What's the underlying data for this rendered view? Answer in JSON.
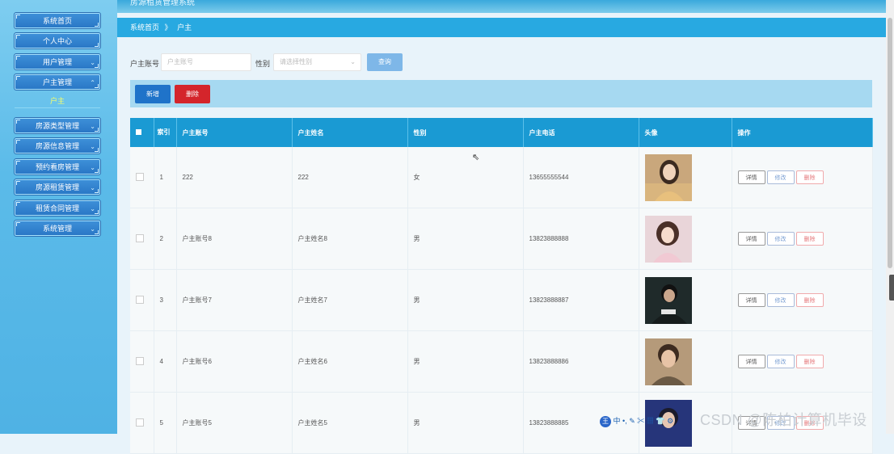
{
  "topbar": {
    "title": "房源租赁管理系统"
  },
  "sidebar": {
    "items": [
      {
        "label": "系统首页"
      },
      {
        "label": "个人中心"
      },
      {
        "label": "用户管理"
      },
      {
        "label": "户主管理"
      },
      {
        "label": "房源类型管理"
      },
      {
        "label": "房源信息管理"
      },
      {
        "label": "预约看房管理"
      },
      {
        "label": "房源租赁管理"
      },
      {
        "label": "租赁合同管理"
      },
      {
        "label": "系统管理"
      }
    ],
    "sub_item": "户主"
  },
  "breadcrumb": {
    "home": "系统首页",
    "separator": "》",
    "current": "户主"
  },
  "search": {
    "account_label": "户主账号",
    "account_placeholder": "户主账号",
    "gender_label": "性别",
    "gender_placeholder": "请选择性别",
    "search_button": "查询"
  },
  "actions": {
    "add": "新增",
    "delete": "删除"
  },
  "table": {
    "headers": [
      "",
      "索引",
      "户主账号",
      "户主姓名",
      "性别",
      "户主电话",
      "头像",
      "操作"
    ],
    "rows": [
      {
        "index": "1",
        "account": "222",
        "name": "222",
        "gender": "女",
        "phone": "13655555544"
      },
      {
        "index": "2",
        "account": "户主账号8",
        "name": "户主姓名8",
        "gender": "男",
        "phone": "13823888888"
      },
      {
        "index": "3",
        "account": "户主账号7",
        "name": "户主姓名7",
        "gender": "男",
        "phone": "13823888887"
      },
      {
        "index": "4",
        "account": "户主账号6",
        "name": "户主姓名6",
        "gender": "男",
        "phone": "13823888886"
      },
      {
        "index": "5",
        "account": "户主账号5",
        "name": "户主姓名5",
        "gender": "男",
        "phone": "13823888885"
      }
    ],
    "ops": {
      "detail": "详情",
      "edit": "修改",
      "delete": "删除"
    }
  },
  "ime_toolbar": {
    "badge": "王",
    "mode": "中"
  },
  "watermark": "CSDN @陈柏计算机毕设",
  "colors": {
    "sidebar": "#5bbbe9",
    "header": "#1a9ad3",
    "primary": "#1f73c9",
    "danger": "#d4252b"
  }
}
